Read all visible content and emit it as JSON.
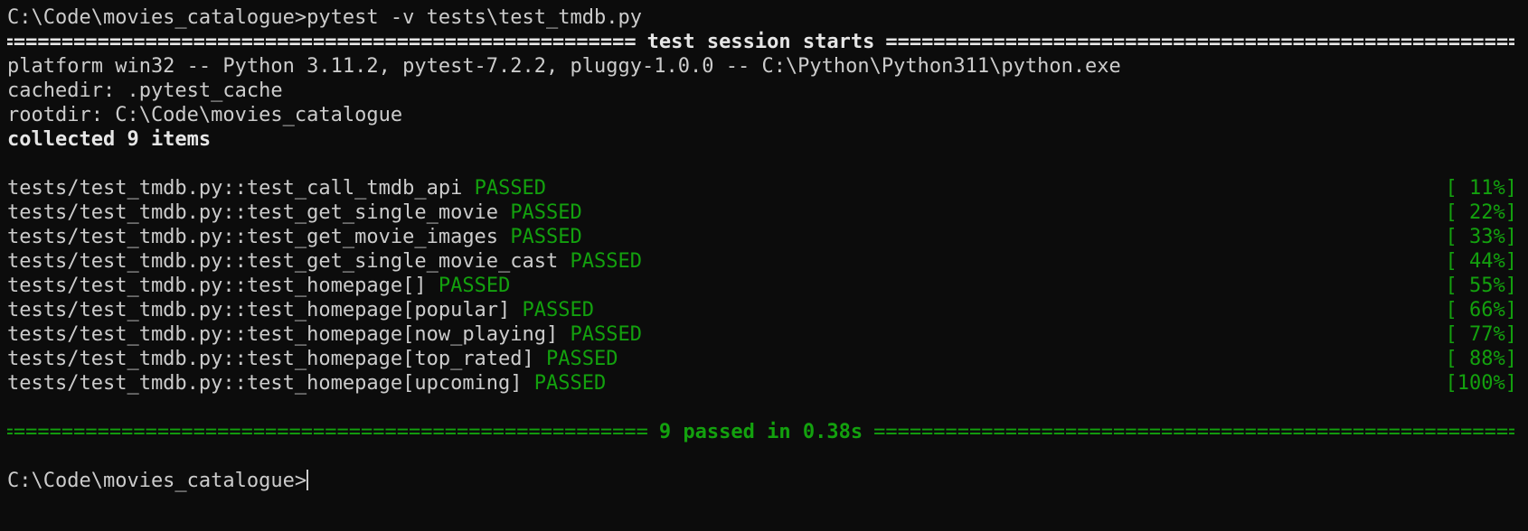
{
  "terminal": {
    "prompt": "C:\\Code\\movies_catalogue>",
    "command": "pytest -v tests\\test_tmdb.py",
    "session_header": "test session starts",
    "info_lines": [
      "platform win32 -- Python 3.11.2, pytest-7.2.2, pluggy-1.0.0 -- C:\\Python\\Python311\\python.exe",
      "cachedir: .pytest_cache",
      "rootdir: C:\\Code\\movies_catalogue"
    ],
    "collected": "collected 9 items",
    "tests": [
      {
        "name": "tests/test_tmdb.py::test_call_tmdb_api",
        "status": "PASSED",
        "progress": "[ 11%]"
      },
      {
        "name": "tests/test_tmdb.py::test_get_single_movie",
        "status": "PASSED",
        "progress": "[ 22%]"
      },
      {
        "name": "tests/test_tmdb.py::test_get_movie_images",
        "status": "PASSED",
        "progress": "[ 33%]"
      },
      {
        "name": "tests/test_tmdb.py::test_get_single_movie_cast",
        "status": "PASSED",
        "progress": "[ 44%]"
      },
      {
        "name": "tests/test_tmdb.py::test_homepage[]",
        "status": "PASSED",
        "progress": "[ 55%]"
      },
      {
        "name": "tests/test_tmdb.py::test_homepage[popular]",
        "status": "PASSED",
        "progress": "[ 66%]"
      },
      {
        "name": "tests/test_tmdb.py::test_homepage[now_playing]",
        "status": "PASSED",
        "progress": "[ 77%]"
      },
      {
        "name": "tests/test_tmdb.py::test_homepage[top_rated]",
        "status": "PASSED",
        "progress": "[ 88%]"
      },
      {
        "name": "tests/test_tmdb.py::test_homepage[upcoming]",
        "status": "PASSED",
        "progress": "[100%]"
      }
    ],
    "summary": "9 passed in 0.38s",
    "final_prompt": "C:\\Code\\movies_catalogue>"
  },
  "colors": {
    "background": "#0c0c0c",
    "text": "#cccccc",
    "green": "#13a10e"
  }
}
